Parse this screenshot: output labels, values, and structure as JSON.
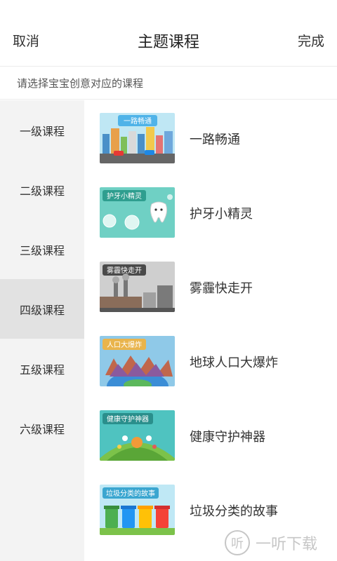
{
  "header": {
    "cancel": "取消",
    "title": "主题课程",
    "done": "完成"
  },
  "hint": "请选择宝宝创意对应的课程",
  "levels": [
    {
      "label": "一级课程"
    },
    {
      "label": "二级课程"
    },
    {
      "label": "三级课程"
    },
    {
      "label": "四级课程",
      "active": true
    },
    {
      "label": "五级课程"
    },
    {
      "label": "六级课程"
    }
  ],
  "courses": [
    {
      "name": "一路畅通",
      "thumb_text": "一路畅通",
      "bg": "#bfe7f4"
    },
    {
      "name": "护牙小精灵",
      "thumb_text": "护牙小精灵",
      "bg": "#6fd0c4"
    },
    {
      "name": "雾霾快走开",
      "thumb_text": "雾霾快走开",
      "bg": "#cfcfcf"
    },
    {
      "name": "地球人口大爆炸",
      "thumb_text": "人口大爆炸",
      "bg": "#8fc9e8"
    },
    {
      "name": "健康守护神器",
      "thumb_text": "健康守护神器",
      "bg": "#4fc3c0"
    },
    {
      "name": "垃圾分类的故事",
      "thumb_text": "垃圾分类的故事",
      "bg": "#bfe8f5"
    }
  ],
  "watermark": {
    "text": "一听下载",
    "logo_char": "听"
  }
}
